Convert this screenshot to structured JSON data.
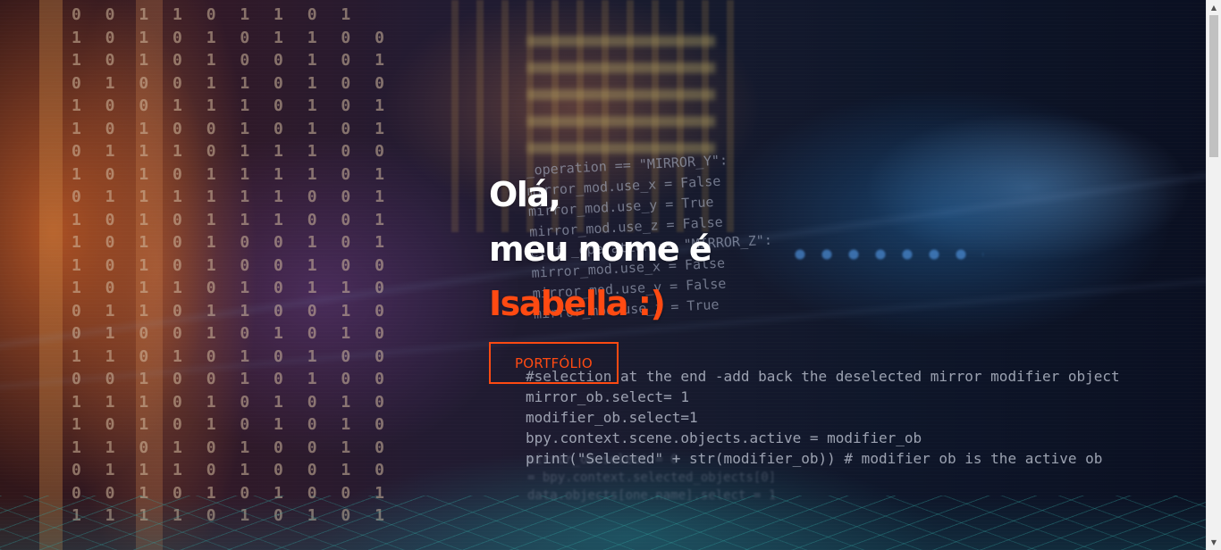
{
  "hero": {
    "greeting": "Olá,",
    "intro": "meu nome é",
    "name": "Isabella :)",
    "cta_label": "PORTFÓLIO",
    "accent_color": "#ff4a12"
  },
  "background": {
    "binary_rows": [
      "0 0 1 1 0 1 1 0 1",
      "1 0 1 0 1 0 1 1 0 0",
      "1 0 1 0 1 0 0 1 0 1",
      "0 1 0 0 1 1 0 1 0 0",
      "1 0 0 1 1 1 0 1 0 1",
      "1 0 1 0 0 1 0 1 0 1",
      "0 1 1 1 0 1 1 1 0 0",
      "1 0 1 0 1 1 1 1 0 1",
      "0 1 1 1 1 1 1 0 0 1",
      "1 0 1 0 1 1 1 0 0 1",
      "1 0 1 0 1 0 0 1 0 1",
      "1 0 1 0 1 0 0 1 0 0",
      "1 0 1 1 0 1 0 1 1 0",
      "0 1 1 0 1 1 0 0 1 0",
      "0 1 0 0 1 0 1 0 1 0",
      "1 1 0 1 0 1 0 1 0 0",
      "0 0 1 0 0 1 0 1 0 0",
      "1 1 1 0 1 0 1 0 1 0",
      "1 0 1 0 1 0 1 0 1 0",
      "1 1 0 1 0 1 0 0 1 0",
      "0 1 1 1 0 1 0 0 1 0",
      "0 0 1 0 1 0 1 0 0 1",
      "1 1 1 1 0 1 0 1 0 1"
    ],
    "code_upper": [
      "_operation == \"MIRROR_Y\":",
      "mirror_mod.use_x = False",
      "mirror_mod.use_y = True",
      "mirror_mod.use_z = False",
      "elif _operation == \"MIRROR_Z\":",
      "mirror_mod.use_x = False",
      "mirror_mod.use_y = False",
      "mirror_mod.use_z = True"
    ],
    "code_lower": [
      "#selection at the end -add back the deselected mirror modifier object",
      "mirror_ob.select= 1",
      "modifier_ob.select=1",
      "bpy.context.scene.objects.active = modifier_ob",
      "print(\"Selected\" + str(modifier_ob)) # modifier ob is the active ob"
    ],
    "code_faint": [
      "mirror_ob.select = 0",
      "= bpy.context.selected_objects[0]",
      "data.objects[one.name].select = 1"
    ]
  },
  "scrollbar": {
    "up_arrow": "▲",
    "down_arrow": "▼"
  }
}
